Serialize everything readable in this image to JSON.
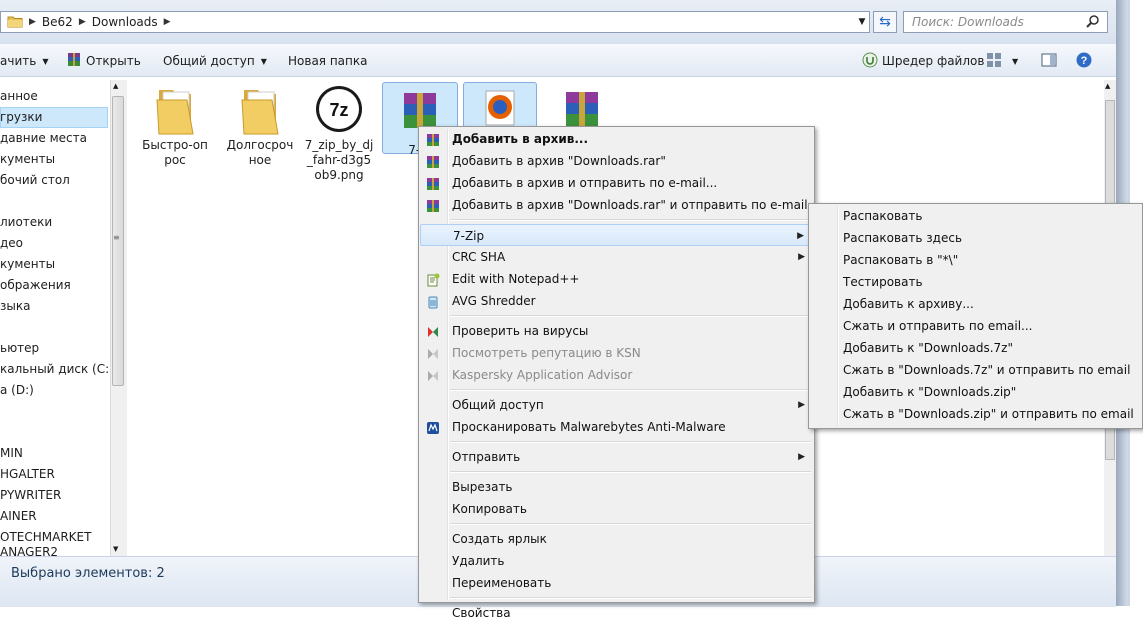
{
  "address": {
    "crumbs": [
      "Be62",
      "Downloads"
    ]
  },
  "search": {
    "placeholder": "Поиск: Downloads"
  },
  "toolbar": {
    "organize_label": "ачить",
    "open_label": "Открыть",
    "share_label": "Общий доступ",
    "new_folder_label": "Новая папка",
    "shredder_label": "Шредер файлов"
  },
  "nav": {
    "items": [
      "анное",
      "грузки",
      "давние места",
      "кументы",
      "бочий стол",
      "лиотеки",
      "део",
      "кументы",
      "ображения",
      "зыка",
      "ьютер",
      "кальный диск (C:)",
      "а (D:)",
      "MIN",
      "HGALTER",
      "PYWRITER",
      "AINER",
      "OTECHMARKET",
      "ANAGER2"
    ]
  },
  "files": [
    {
      "name": "Быстро-оп рос",
      "icon": "folder-icon"
    },
    {
      "name": "Долгосроч ное",
      "icon": "folder-icon"
    },
    {
      "name": "7_zip_by_dj _fahr-d3g5 ob9.png",
      "icon": "7zip-image-icon"
    },
    {
      "name": "7-Zi",
      "icon": "winrar-archive-icon"
    },
    {
      "name": "",
      "icon": "firefox-icon"
    },
    {
      "name": "",
      "icon": "winrar-archive-icon"
    }
  ],
  "context_menu": {
    "items": [
      {
        "label": "Добавить в архив...",
        "icon": "winrar-icon",
        "bold": true
      },
      {
        "label": "Добавить в архив \"Downloads.rar\"",
        "icon": "winrar-icon"
      },
      {
        "label": "Добавить в архив и отправить по e-mail...",
        "icon": "winrar-icon"
      },
      {
        "label": "Добавить в архив \"Downloads.rar\" и отправить по e-mail",
        "icon": "winrar-icon"
      },
      {
        "label": "7-Zip",
        "submenu": true,
        "highlight": true
      },
      {
        "label": "CRC SHA",
        "submenu": true
      },
      {
        "label": "Edit with Notepad++",
        "icon": "notepad-plus-icon"
      },
      {
        "label": "AVG Shredder",
        "icon": "avg-shredder-icon"
      },
      {
        "label": "Проверить на вирусы",
        "icon": "kaspersky-icon"
      },
      {
        "label": "Посмотреть репутацию в KSN",
        "icon": "kaspersky-gray-icon",
        "disabled": true
      },
      {
        "label": "Kaspersky Application Advisor",
        "icon": "kaspersky-gray-icon",
        "disabled": true
      },
      {
        "label": "Общий доступ",
        "submenu": true
      },
      {
        "label": "Просканировать Malwarebytes Anti-Malware",
        "icon": "malwarebytes-icon"
      },
      {
        "label": "Отправить",
        "submenu": true
      },
      {
        "label": "Вырезать"
      },
      {
        "label": "Копировать"
      },
      {
        "label": "Создать ярлык"
      },
      {
        "label": "Удалить"
      },
      {
        "label": "Переименовать"
      },
      {
        "label": "Свойства"
      }
    ]
  },
  "submenu_7zip": {
    "items": [
      "Распаковать",
      "Распаковать здесь",
      "Распаковать в \"*\\\"",
      "Тестировать",
      "Добавить к архиву...",
      "Сжать и отправить по email...",
      "Добавить к \"Downloads.7z\"",
      "Сжать в \"Downloads.7z\" и отправить по email",
      "Добавить к \"Downloads.zip\"",
      "Сжать в \"Downloads.zip\" и отправить по email"
    ]
  },
  "status": {
    "text": "Выбрано элементов: 2"
  }
}
